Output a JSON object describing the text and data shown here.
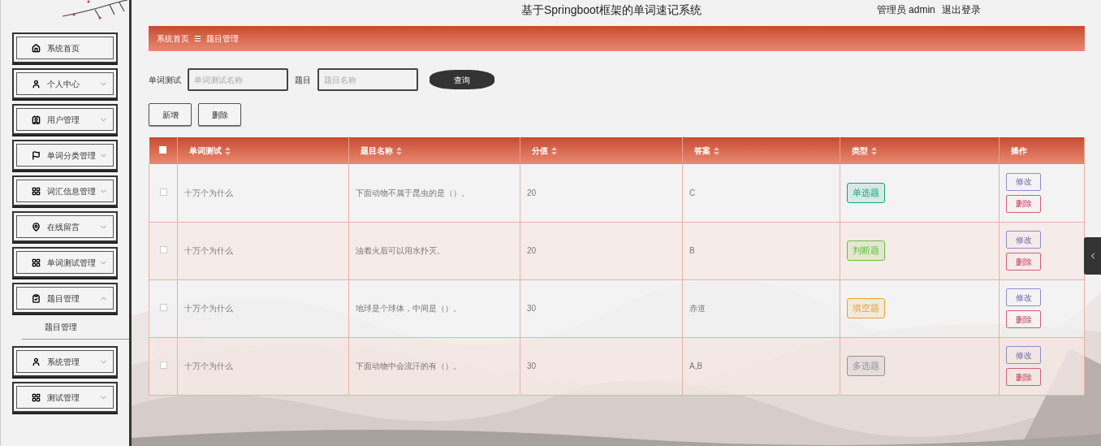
{
  "header": {
    "title": "基于Springboot框架的单词速记系统",
    "user": "管理员 admin",
    "logout": "退出登录"
  },
  "sidebar": {
    "items": [
      {
        "label": "系统首页",
        "kind": "link"
      },
      {
        "label": "个人中心",
        "kind": "menu",
        "expanded": false
      },
      {
        "label": "用户管理",
        "kind": "menu",
        "expanded": false
      },
      {
        "label": "单词分类管理",
        "kind": "menu",
        "expanded": false
      },
      {
        "label": "词汇信息管理",
        "kind": "menu",
        "expanded": false
      },
      {
        "label": "在线留言",
        "kind": "menu",
        "expanded": false
      },
      {
        "label": "单词测试管理",
        "kind": "menu",
        "expanded": false
      },
      {
        "label": "题目管理",
        "kind": "menu",
        "expanded": true,
        "children": [
          {
            "label": "题目管理"
          }
        ]
      },
      {
        "label": "系统管理",
        "kind": "menu",
        "expanded": false
      },
      {
        "label": "测试管理",
        "kind": "menu",
        "expanded": false
      }
    ]
  },
  "breadcrumb": {
    "home": "系统首页",
    "separator": "☰",
    "current": "题目管理"
  },
  "search": {
    "fields": [
      {
        "label": "单词测试",
        "placeholder": "单词测试名称"
      },
      {
        "label": "题目",
        "placeholder": "题目名称"
      }
    ],
    "button": "查询"
  },
  "actions": [
    "新增",
    "删除"
  ],
  "table": {
    "select_all": {
      "checked": false
    },
    "columns": [
      {
        "label": "单词测试",
        "sortable": true
      },
      {
        "label": "题目名称",
        "sortable": true
      },
      {
        "label": "分值",
        "sortable": true
      },
      {
        "label": "答案",
        "sortable": true
      },
      {
        "label": "类型",
        "sortable": true
      },
      {
        "label": "操作",
        "sortable": false
      }
    ],
    "rows": [
      {
        "checked": false,
        "test": "十万个为什么",
        "question": "下面动物不属于昆虫的是（）。",
        "score": "20",
        "answer": "C",
        "type": {
          "label": "单选题",
          "color": "#13a37a"
        },
        "edit": "修改",
        "delete": "删除"
      },
      {
        "checked": false,
        "test": "十万个为什么",
        "question": "油着火后可以用水扑灭。",
        "score": "20",
        "answer": "B",
        "type": {
          "label": "判断题",
          "color": "#67c23a"
        },
        "edit": "修改",
        "delete": "删除"
      },
      {
        "checked": false,
        "test": "十万个为什么",
        "question": "地球是个球体，中间是（）。",
        "score": "30",
        "answer": "赤道",
        "type": {
          "label": "填空题",
          "color": "#e6a23c"
        },
        "edit": "修改",
        "delete": "删除"
      },
      {
        "checked": false,
        "test": "十万个为什么",
        "question": "下面动物中会流汗的有（）。",
        "score": "30",
        "answer": "A,B",
        "type": {
          "label": "多选题",
          "color": "#909399"
        },
        "edit": "修改",
        "delete": "删除"
      }
    ]
  }
}
